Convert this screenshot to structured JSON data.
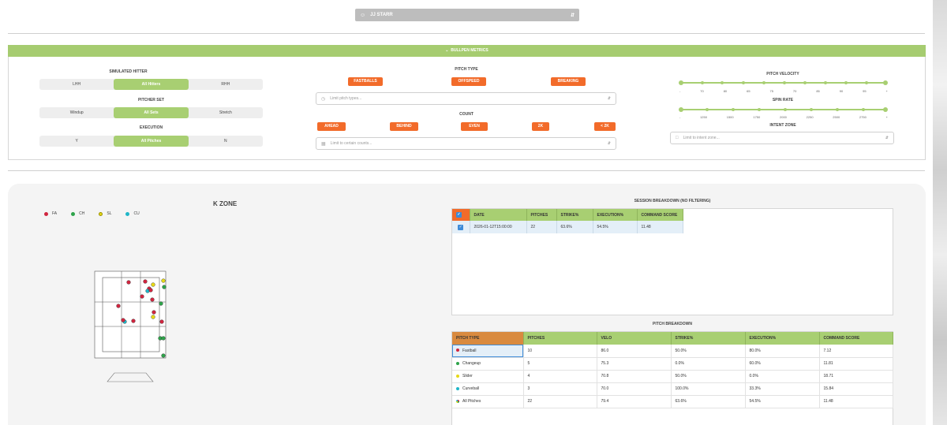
{
  "header": {
    "user": "JJ STARR"
  },
  "metrics_bar": {
    "label": "BULLPEN METRICS"
  },
  "hitter": {
    "title": "SIMULATED HITTER",
    "options": [
      "LHH",
      "All Hitters",
      "RHH"
    ],
    "selected": "All Hitters"
  },
  "pitcher_set": {
    "title": "PITCHER SET",
    "options": [
      "Windup",
      "All Sets",
      "Stretch"
    ],
    "selected": "All Sets"
  },
  "execution": {
    "title": "EXECUTION",
    "options": [
      "Y",
      "All Pitches",
      "N"
    ],
    "selected": "All Pitches"
  },
  "pitch_type": {
    "title": "PITCH TYPE",
    "buttons": [
      "FASTBALLS",
      "OFFSPEED",
      "BREAKING"
    ],
    "placeholder": "Limit pitch types..."
  },
  "count": {
    "title": "COUNT",
    "buttons": [
      "AHEAD",
      "BEHIND",
      "EVEN",
      "2K",
      "< 2K"
    ],
    "placeholder": "Limit to certain counts..."
  },
  "velocity": {
    "title": "PITCH VELOCITY",
    "ticks": [
      "-",
      "70",
      "80",
      "65",
      "75",
      "70",
      "85",
      "90",
      "95",
      "+"
    ]
  },
  "spin": {
    "title": "SPIN RATE",
    "ticks": [
      "-",
      "1250",
      "1500",
      "1750",
      "2000",
      "2250",
      "2500",
      "2750",
      "+"
    ]
  },
  "intent_zone": {
    "title": "INTENT ZONE",
    "placeholder": "Limit to intent zone..."
  },
  "kzone": {
    "title": "K ZONE",
    "legend": [
      {
        "code": "FA",
        "color": "#d0253f"
      },
      {
        "code": "CH",
        "color": "#2ea34a"
      },
      {
        "code": "SL",
        "color": "#e6d817"
      },
      {
        "code": "CU",
        "color": "#1fb6c8"
      }
    ]
  },
  "session": {
    "title": "SESSION BREAKDOWN (NO FILTERING)",
    "columns": [
      "DATE",
      "PITCHES",
      "STRIKE%",
      "EXECUTION%",
      "COMMAND SCORE"
    ],
    "rows": [
      {
        "date": "2026-01-12T15:00:00",
        "pitches": "22",
        "strike": "63.6%",
        "execution": "54.5%",
        "command": "11.48"
      }
    ]
  },
  "pitch_breakdown": {
    "title": "PITCH BREAKDOWN",
    "columns": [
      "PITCH TYPE",
      "PITCHES",
      "VELO",
      "STRIKE%",
      "EXECUTION%",
      "COMMAND SCORE"
    ],
    "rows": [
      {
        "type": "Fastball",
        "color": "#d0253f",
        "pitches": "10",
        "velo": "86.0",
        "strike": "50.0%",
        "execution": "80.0%",
        "command": "7.12"
      },
      {
        "type": "Changeup",
        "color": "#2ea34a",
        "pitches": "5",
        "velo": "75.3",
        "strike": "0.0%",
        "execution": "60.0%",
        "command": "11.81"
      },
      {
        "type": "Slider",
        "color": "#e6d817",
        "pitches": "4",
        "velo": "70.8",
        "strike": "50.0%",
        "execution": "0.0%",
        "command": "18.71"
      },
      {
        "type": "Curveball",
        "color": "#1fb6c8",
        "pitches": "3",
        "velo": "70.0",
        "strike": "100.0%",
        "execution": "33.3%",
        "command": "15.84"
      },
      {
        "type": "All Pitches",
        "color": "multi",
        "pitches": "22",
        "velo": "79.4",
        "strike": "63.6%",
        "execution": "54.5%",
        "command": "11.48"
      }
    ]
  }
}
